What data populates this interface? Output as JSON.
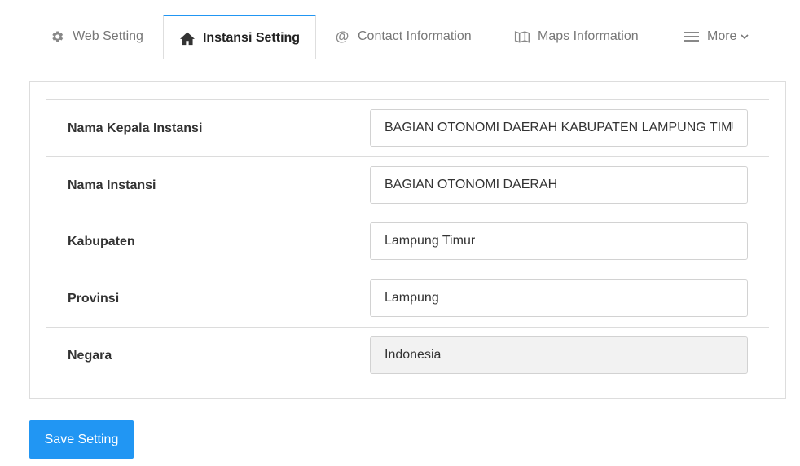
{
  "tabs": [
    {
      "label": "Web Setting",
      "icon": "gear-icon"
    },
    {
      "label": "Instansi Setting",
      "icon": "home-icon",
      "active": true
    },
    {
      "label": "Contact Information",
      "icon": "at-sign-icon"
    },
    {
      "label": "Maps Information",
      "icon": "map-icon"
    },
    {
      "label": "More",
      "icon": "menu-icon"
    }
  ],
  "form": {
    "rows": [
      {
        "label": "Nama Kepala Instansi",
        "value": "BAGIAN OTONOMI DAERAH KABUPATEN LAMPUNG TIMUR",
        "readonly": false
      },
      {
        "label": "Nama Instansi",
        "value": "BAGIAN OTONOMI DAERAH",
        "readonly": false
      },
      {
        "label": "Kabupaten",
        "value": "Lampung Timur",
        "readonly": false
      },
      {
        "label": "Provinsi",
        "value": "Lampung",
        "readonly": false
      },
      {
        "label": "Negara",
        "value": "Indonesia",
        "readonly": true
      }
    ]
  },
  "actions": {
    "save_label": "Save Setting"
  },
  "colors": {
    "accent": "#2196f3",
    "readonly_bg": "#f2f2f2"
  }
}
